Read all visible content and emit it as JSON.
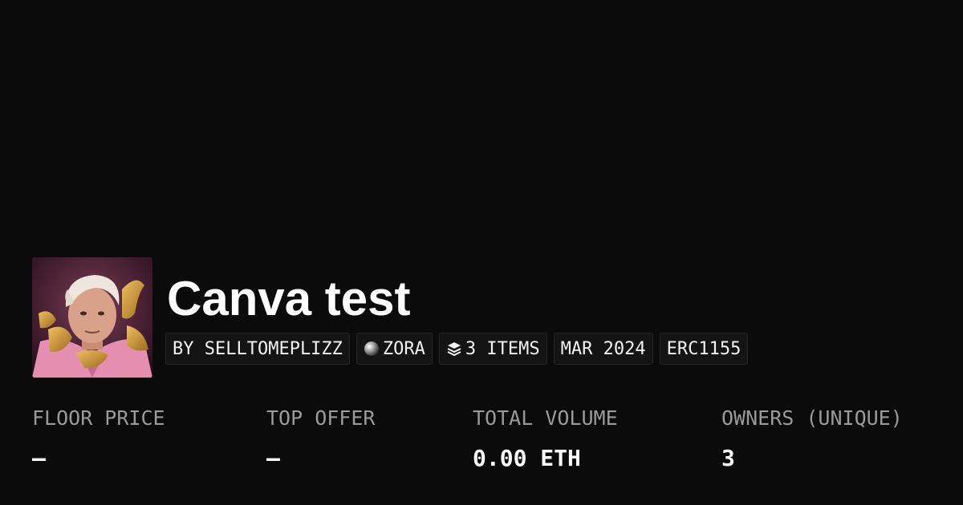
{
  "collection": {
    "title": "Canva test",
    "avatar_icon": "collection-artwork"
  },
  "tags": {
    "creator": "BY SELLTOMEPLIZZ",
    "chain": "ZORA",
    "chain_icon": "zora-orb-icon",
    "items": "3 ITEMS",
    "items_icon": "layers-icon",
    "date": "MAR 2024",
    "standard": "ERC1155"
  },
  "stats": {
    "floor_price": {
      "label": "FLOOR PRICE",
      "value": "–"
    },
    "top_offer": {
      "label": "TOP OFFER",
      "value": "–"
    },
    "total_volume": {
      "label": "TOTAL VOLUME",
      "value": "0.00 ETH"
    },
    "owners": {
      "label": "OWNERS (UNIQUE)",
      "value": "3"
    }
  },
  "colors": {
    "background": "#0b0b0b",
    "label": "#9a9a9a",
    "text": "#ffffff"
  }
}
